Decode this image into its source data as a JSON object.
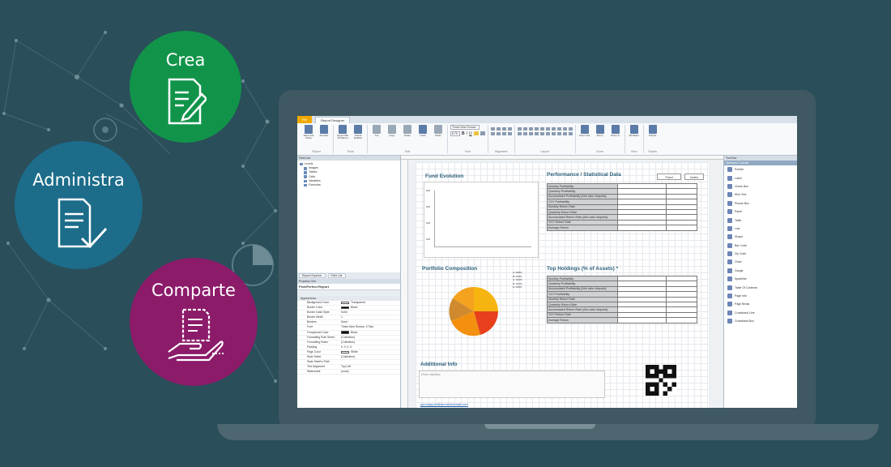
{
  "bubbles": {
    "create": "Crea",
    "manage": "Administra",
    "share": "Comparte"
  },
  "app": {
    "tabs": {
      "file": "File",
      "active": "Report Designer"
    },
    "ribbon": {
      "groups": [
        {
          "name": "Report",
          "buttons": [
            "Save and Close",
            "Preview"
          ]
        },
        {
          "name": "Tools",
          "buttons": [
            "Import INF 16 Report",
            "Check Entities"
          ]
        },
        {
          "name": "Edit",
          "buttons": [
            "Cut",
            "Copy",
            "Paste",
            "Undo",
            "Redo"
          ]
        },
        {
          "name": "Font",
          "font_name": "Times New Roman",
          "font_size": "8.75"
        },
        {
          "name": "Alignment"
        },
        {
          "name": "Layout"
        },
        {
          "name": "Zoom",
          "buttons": [
            "Zoom Out",
            "Zoom",
            "Zoom In"
          ]
        },
        {
          "name": "View",
          "buttons": [
            "Windows"
          ]
        },
        {
          "name": "Scripts",
          "buttons": [
            "Scripts"
          ]
        }
      ]
    },
    "field_list": {
      "title": "Field List",
      "items": [
        "Levels",
        "Images",
        "Tables",
        "Cells",
        "Variables",
        "Formulas"
      ]
    },
    "panel_tabs": [
      "Report Explorer",
      "Field List"
    ],
    "property_grid": {
      "title": "Property Grid",
      "object": "PixelPerfect  Report",
      "category": "Appearance",
      "rows": [
        {
          "k": "Background Color",
          "v": "Transparent",
          "swatch": "#ffffff"
        },
        {
          "k": "Border Color",
          "v": "Black",
          "swatch": "#000000"
        },
        {
          "k": "Border Dash Style",
          "v": "Solid"
        },
        {
          "k": "Border Width",
          "v": "1"
        },
        {
          "k": "Borders",
          "v": "None"
        },
        {
          "k": "Font",
          "v": "Times New Roman, 9.75pt"
        },
        {
          "k": "Foreground Color",
          "v": "Black",
          "swatch": "#000000"
        },
        {
          "k": "Formatting Rule Sheet",
          "v": "(Collection)"
        },
        {
          "k": "Formatting Rules",
          "v": "(Collection)"
        },
        {
          "k": "Padding",
          "v": "0, 0, 0, 0"
        },
        {
          "k": "Page Color",
          "v": "White",
          "swatch": "#ffffff"
        },
        {
          "k": "Style Sheet",
          "v": "(Collection)"
        },
        {
          "k": "Style Sheet's Path",
          "v": ""
        },
        {
          "k": "Text Alignment",
          "v": "Top Left"
        },
        {
          "k": "Watermark",
          "v": "(none)"
        }
      ]
    },
    "report": {
      "fund_evolution": "Fund Evolution",
      "fund_axis": [
        "100",
        "100",
        "100",
        "100"
      ],
      "performance_title": "Performance / Statistical Data",
      "col_fund": "Fund",
      "col_index": "Index",
      "performance_rows": [
        "Monthly Profitability",
        "Quarterly Profitability",
        "Accumulated Profitability [Año valor etiqueta]",
        "YOY Profitability",
        "Monthly Return Rate",
        "Quarterly Return Rate",
        "Accumulated Return Rate [Año valor etiqueta]",
        "YOY Return Rate",
        "Average Return"
      ],
      "portfolio_title": "Portfolio Composition",
      "portfolio_legend": [
        "A: 000%",
        "B: 000%",
        "C: 010%",
        "D: 010%",
        "E: 000%"
      ],
      "holdings_title": "Top Holdings (% of Assets) *",
      "holdings_rows": [
        "Monthly Profitability",
        "Quarterly Profitability",
        "Accumulated Profitability [Año valor etiqueta]",
        "YOY Profitability",
        "Monthly Return Rate",
        "Quarterly Return Rate",
        "Accumulated Return Rate [Año valor etiqueta]",
        "YOY Return Rate",
        "Average Return"
      ],
      "additional_info": "Additional Info",
      "textbox_placeholder": "[Texto objetivo]",
      "email": "yoursupport@acmeinformail.com"
    },
    "toolbox": {
      "title": "Tool Box",
      "section": "Standard Controls",
      "items": [
        "Pointer",
        "Label",
        "Check Box",
        "Rich Text",
        "Picture Box",
        "Panel",
        "Table",
        "Line",
        "Shape",
        "Bar Code",
        "Zip Code",
        "Chart",
        "Gauge",
        "Sparkline",
        "Table Of Contents",
        "Page Info",
        "Page Break",
        "Crossband Line",
        "Crossband Box"
      ]
    }
  }
}
